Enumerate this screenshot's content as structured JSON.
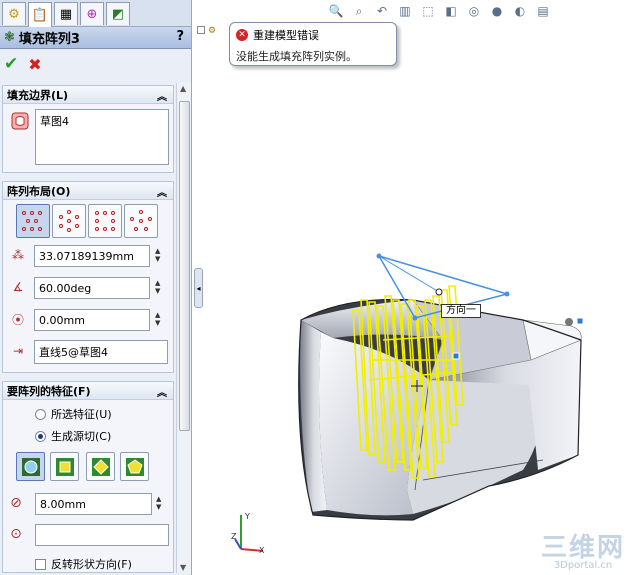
{
  "feature_title": "填充阵列3",
  "help_symbol": "?",
  "tabs": [
    {
      "name": "feature-manager",
      "glyph": "⚙"
    },
    {
      "name": "property-manager",
      "glyph": "📋"
    },
    {
      "name": "configuration-manager",
      "glyph": "▦"
    },
    {
      "name": "dimxpert",
      "glyph": "⊕"
    },
    {
      "name": "display-manager",
      "glyph": "◩"
    }
  ],
  "fill_boundary": {
    "header": "填充边界(L)",
    "list_items": [
      "草图4"
    ]
  },
  "pattern_layout": {
    "header": "阵列布局(O)",
    "spacing": "33.07189139mm",
    "angle": "60.00deg",
    "margin": "0.00mm",
    "direction": "直线5@草图4"
  },
  "features_to_pattern": {
    "header": "要阵列的特征(F)",
    "radio_selected_features": "所选特征(U)",
    "radio_create_seed_cut": "生成源切(C)",
    "diameter": "8.00mm",
    "vertex_value": "",
    "flip_shape": "反转形状方向(F)"
  },
  "tooltip": {
    "title": "重建模型错误",
    "message": "没能生成填充阵列实例。"
  },
  "viewport": {
    "direction_callout": "方向一",
    "toolbar_icons": [
      "zoom-to-fit-icon",
      "zoom-area-icon",
      "previous-view-icon",
      "section-view-icon",
      "view-orientation-icon",
      "display-style-icon",
      "hide-show-icon",
      "appearance-icon",
      "scene-icon",
      "view-settings-icon"
    ]
  },
  "watermark": {
    "line1": "三维网",
    "line2": "3Dportal.cn"
  },
  "colors": {
    "sketch_blue": "#4a90e2",
    "pattern_yellow": "#f7f000",
    "error_red": "#d32323",
    "ok_green": "#2a9a2a"
  }
}
